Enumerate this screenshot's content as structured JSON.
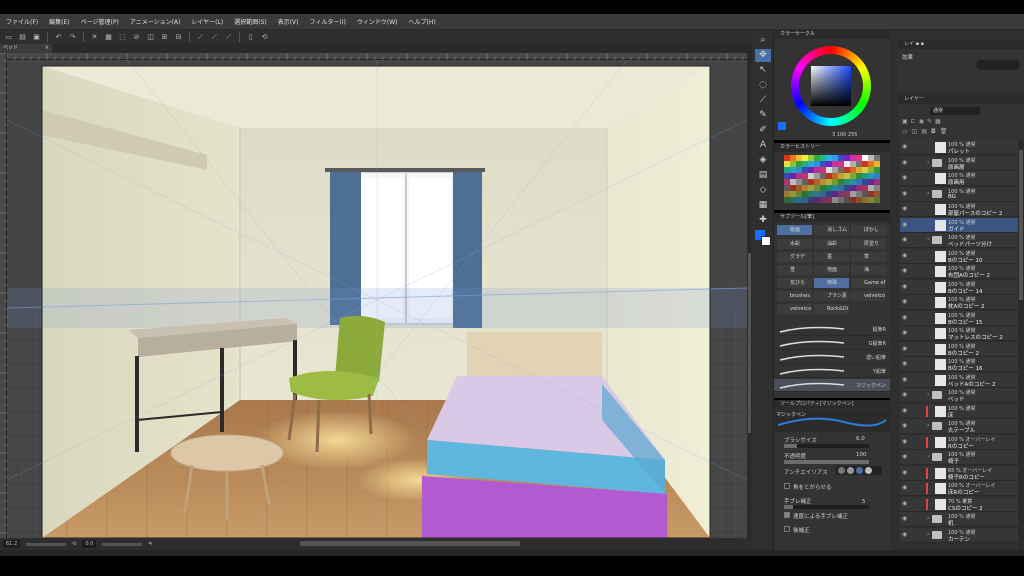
{
  "menu": [
    "ファイル(F)",
    "編集(E)",
    "ページ管理(P)",
    "アニメーション(A)",
    "レイヤー(L)",
    "選択範囲(S)",
    "表示(V)",
    "フィルター(I)",
    "ウィンドウ(W)",
    "ヘルプ(H)"
  ],
  "document_tab": "ベッド",
  "status": {
    "zoom": "61.2",
    "angle": "0.0"
  },
  "color_panel": {
    "title": "カラーサークル",
    "values": "3  100  255",
    "accent": "#1a6cff",
    "history_title": "カラーヒストリー"
  },
  "subtool": {
    "title": "サブツール[筆]",
    "tabs": [
      "絵画",
      "水彩",
      "油彩",
      "厚塗り",
      "グラデ",
      "墨",
      "草",
      "雪",
      "地面",
      "海",
      "花びら",
      "特殊",
      "Game ef",
      "brushes",
      "ブラシ素",
      "velvetco",
      "velvetco",
      "Rock&Di"
    ],
    "tabs_top": [
      "絵画",
      "消しゴム",
      "ぼかし"
    ],
    "brushes": [
      "鉛筆R",
      "G鉛筆R",
      "濃い鉛筆",
      "Y鉛筆",
      "マジックペン"
    ]
  },
  "tool_property": {
    "title": "ツールプロパティ[マジックペン]",
    "preset": "マジックペン",
    "brush_size_label": "ブラシサイズ",
    "brush_size_value": "6.0",
    "opacity_label": "不透明度",
    "opacity_value": "100",
    "antialias_label": "アンチエイリアス",
    "corner_label": "角をとがらせる",
    "stabilize_label": "手ブレ補正",
    "stabilize_value": "5",
    "speed_stabilize_label": "速度による手ブレ補正",
    "post_correct_label": "後補正"
  },
  "layer_panel": {
    "header_label": "効果",
    "title": "レイヤー",
    "blend": "通常",
    "layers": [
      {
        "mode": "100 % 通常",
        "name": "パレット",
        "type": "layer",
        "color": ""
      },
      {
        "mode": "100 % 通常",
        "name": "原画層",
        "type": "folder",
        "color": ""
      },
      {
        "mode": "100 % 通常",
        "name": "原画用",
        "type": "layer",
        "color": ""
      },
      {
        "mode": "100 % 通常",
        "name": "BG",
        "type": "folder",
        "color": ""
      },
      {
        "mode": "100 % 通常",
        "name": "部屋パースのコピー 2",
        "type": "layer",
        "color": ""
      },
      {
        "mode": "100 % 通常",
        "name": "ガイド",
        "type": "layer",
        "color": "",
        "selected": true
      },
      {
        "mode": "100 % 通常",
        "name": "ベッドパーツ分け",
        "type": "folder",
        "color": ""
      },
      {
        "mode": "100 % 通常",
        "name": "Bのコピー 10",
        "type": "layer",
        "color": ""
      },
      {
        "mode": "100 % 通常",
        "name": "布団Aのコピー 2",
        "type": "layer",
        "color": ""
      },
      {
        "mode": "100 % 通常",
        "name": "Bのコピー 14",
        "type": "layer",
        "color": ""
      },
      {
        "mode": "100 % 通常",
        "name": "枕Aのコピー 2",
        "type": "layer",
        "color": ""
      },
      {
        "mode": "100 % 通常",
        "name": "Bのコピー 15",
        "type": "layer",
        "color": ""
      },
      {
        "mode": "100 % 通常",
        "name": "マットレスのコピー 2",
        "type": "layer",
        "color": ""
      },
      {
        "mode": "100 % 通常",
        "name": "Bのコピー 2",
        "type": "layer",
        "color": ""
      },
      {
        "mode": "100 % 通常",
        "name": "Bのコピー 16",
        "type": "layer",
        "color": ""
      },
      {
        "mode": "100 % 通常",
        "name": "ベッドAのコピー 2",
        "type": "layer",
        "color": ""
      },
      {
        "mode": "100 % 通常",
        "name": "ベッド",
        "type": "folder",
        "color": ""
      },
      {
        "mode": "100 % 通常",
        "name": "床",
        "type": "layer",
        "color": "#e04545"
      },
      {
        "mode": "100 % 通常",
        "name": "丸テーブル",
        "type": "folder",
        "color": ""
      },
      {
        "mode": "100 % オーバーレイ",
        "name": "Rのコピー",
        "type": "layer",
        "color": "#e04545"
      },
      {
        "mode": "100 % 通常",
        "name": "椅子",
        "type": "folder",
        "color": ""
      },
      {
        "mode": "65 % オーバーレイ",
        "name": "椅子Rのコピー",
        "type": "layer",
        "color": "#e04545"
      },
      {
        "mode": "100 % オーバーレイ",
        "name": "床Rのコピー",
        "type": "layer",
        "color": "#e04545"
      },
      {
        "mode": "70 % 乗算",
        "name": "CSのコピー 2",
        "type": "layer",
        "color": "#e04545"
      },
      {
        "mode": "100 % 通常",
        "name": "机",
        "type": "folder",
        "color": ""
      },
      {
        "mode": "100 % 通常",
        "name": "カーテン",
        "type": "folder",
        "color": ""
      }
    ]
  }
}
